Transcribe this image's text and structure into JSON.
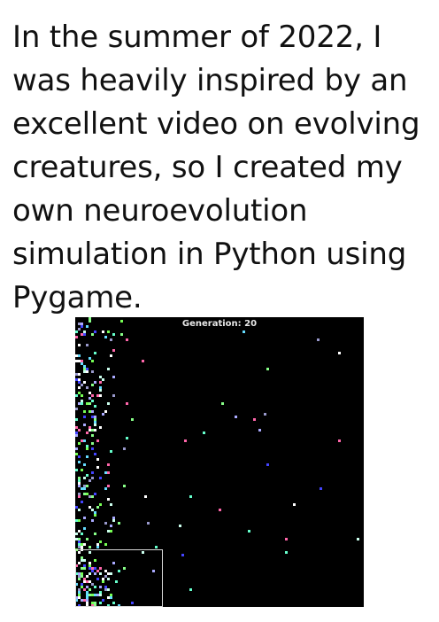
{
  "intro": {
    "text": "In the summer of 2022, I was heavily inspired by an excellent video on evolving creatures, so I created my own neuroevolution simulation in Python using Pygame."
  },
  "simulation": {
    "generation_label": "Generation: 20",
    "background_color": "#000000",
    "safe_zone_color": "#d8d8d8",
    "creature_colors": [
      "#88ff88",
      "#66ffcc",
      "#aaaaff",
      "#4444ff",
      "#ff66aa",
      "#ffffff",
      "#77ff55",
      "#9999cc",
      "#ccffee",
      "#66ddff"
    ]
  }
}
